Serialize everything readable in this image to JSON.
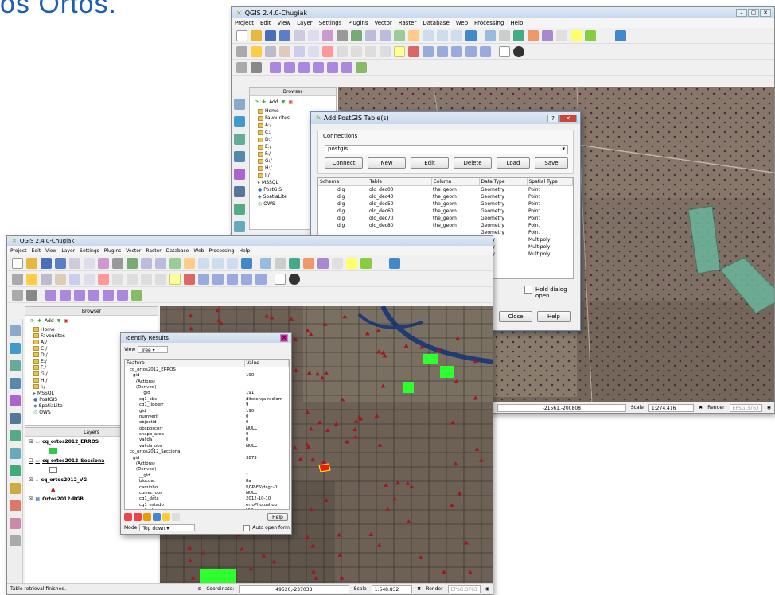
{
  "slide": {
    "title": "os Ortos."
  },
  "back": {
    "title": "QGIS 2.4.0-Chugiak",
    "menu": [
      "Project",
      "Edit",
      "View",
      "Layer",
      "Settings",
      "Plugins",
      "Vector",
      "Raster",
      "Database",
      "Web",
      "Processing",
      "Help"
    ],
    "browser": {
      "title": "Browser",
      "add": "Add",
      "items": [
        "Home",
        "Favourites",
        "A:/",
        "C:/",
        "D:/",
        "E:/",
        "F:/",
        "G:/",
        "H:/",
        "I:/",
        "MSSQL",
        "PostGIS",
        "SpatiaLite",
        "OWS"
      ]
    },
    "status": {
      "coord": "-21561,-200808",
      "scale_label": "Scale",
      "scale": "1:274.416",
      "render": "Render",
      "crs": "EPSG:3763"
    }
  },
  "dialog": {
    "title": "Add PostGIS Table(s)",
    "connections_label": "Connections",
    "connection": "postgis",
    "buttons": {
      "connect": "Connect",
      "new": "New",
      "edit": "Edit",
      "delete": "Delete",
      "load": "Load",
      "save": "Save",
      "close": "Close",
      "help": "Help"
    },
    "columns": [
      "Schema",
      "Table",
      "Column",
      "Data Type",
      "Spatial Type"
    ],
    "rows": [
      [
        "dig",
        "old_dec00",
        "the_geom",
        "Geometry",
        "Point"
      ],
      [
        "dig",
        "old_dec40",
        "the_geom",
        "Geometry",
        "Point"
      ],
      [
        "dig",
        "old_dec50",
        "the_geom",
        "Geometry",
        "Point"
      ],
      [
        "dig",
        "old_dec60",
        "the_geom",
        "Geometry",
        "Point"
      ],
      [
        "dig",
        "old_dec70",
        "the_geom",
        "Geometry",
        "Point"
      ],
      [
        "dig",
        "old_dec80",
        "the_geom",
        "Geometry",
        "Point"
      ],
      [
        "",
        "",
        "",
        "Geometry",
        "Point"
      ],
      [
        "",
        "",
        "",
        "metry",
        "Multipoly"
      ],
      [
        "",
        "",
        "",
        "metry",
        "Multipoly"
      ],
      [
        "",
        "",
        "",
        "metry",
        "Multipoly"
      ]
    ],
    "hold": "Hold dialog open"
  },
  "front": {
    "title": "QGIS 2.4.0-Chugiak",
    "menu": [
      "Project",
      "Edit",
      "View",
      "Layer",
      "Settings",
      "Plugins",
      "Vector",
      "Raster",
      "Database",
      "Web",
      "Processing",
      "Help"
    ],
    "browser": {
      "title": "Browser",
      "add": "Add",
      "items": [
        "Home",
        "Favourites",
        "A:/",
        "C:/",
        "D:/",
        "E:/",
        "F:/",
        "G:/",
        "H:/",
        "I:/",
        "MSSQL",
        "PostGIS",
        "SpatiaLite",
        "OWS"
      ]
    },
    "layers": {
      "title": "Layers",
      "items": [
        "cq_ortos2012_ERROS",
        "cq_ortos2012_Secciona",
        "cq_ortos2012_VG",
        "Ortos2012-RGB"
      ]
    },
    "status": {
      "message": "Table retrieval finished.",
      "coord_label": "Coordinate:",
      "coord": "49520,-237038",
      "scale_label": "Scale",
      "scale": "1:548.832",
      "render": "Render",
      "crs": "EPSG:3763"
    }
  },
  "identify": {
    "title": "Identify Results",
    "view_label": "View",
    "view_value": "Tree",
    "columns": [
      "Feature",
      "Value"
    ],
    "rows": [
      [
        "cq_ortos2012_ERROS",
        ""
      ],
      [
        "gid",
        "190"
      ],
      [
        "(Actions)",
        ""
      ],
      [
        "(Derived)",
        ""
      ],
      [
        "__gid",
        "191"
      ],
      [
        "cq1_obs",
        "diferença radiom"
      ],
      [
        "cq1_tipoerr",
        "9"
      ],
      [
        "gid",
        "190"
      ],
      [
        "numverif",
        "0"
      ],
      [
        "objectid",
        "0"
      ],
      [
        "obsposcorr",
        "NULL"
      ],
      [
        "shape_area",
        "0"
      ],
      [
        "valida",
        "0"
      ],
      [
        "valida_obs",
        "NULL"
      ],
      [
        "cq_ortos2012_Secciona",
        ""
      ],
      [
        "gid",
        "3879"
      ],
      [
        "(Actions)",
        ""
      ],
      [
        "(Derived)",
        ""
      ],
      [
        "__gid",
        "1"
      ],
      [
        "blocoat",
        "8a"
      ],
      [
        "caminho",
        "\\\\GP-FS\\dsgc-0:"
      ],
      [
        "correc_obs",
        "NULL"
      ],
      [
        "cq1_data",
        "2012-10-10"
      ],
      [
        "cq1_estado",
        "erroPhotoshop"
      ],
      [
        "cq1_obs",
        "NULL"
      ]
    ],
    "help": "Help",
    "mode_label": "Mode",
    "mode_value": "Top down",
    "auto_open": "Auto open form"
  }
}
